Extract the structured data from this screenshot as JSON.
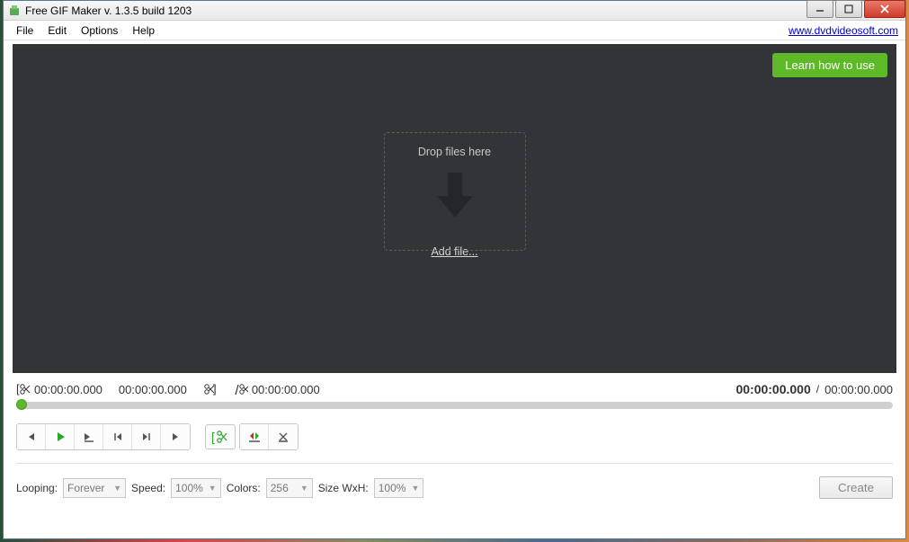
{
  "window": {
    "title": "Free GIF Maker v. 1.3.5 build 1203"
  },
  "menu": {
    "file": "File",
    "edit": "Edit",
    "options": "Options",
    "help": "Help",
    "website": "www.dvdvideosoft.com"
  },
  "preview": {
    "learn_label": "Learn how to use",
    "drop_label": "Drop files here",
    "add_file_label": "Add file..."
  },
  "timeline": {
    "trim_start": "00:00:00.000",
    "trim_duration": "00:00:00.000",
    "trim_end": "00:00:00.000",
    "current": "00:00:00.000",
    "total": "00:00:00.000",
    "slash": "/"
  },
  "settings": {
    "looping_label": "Looping:",
    "looping_value": "Forever",
    "speed_label": "Speed:",
    "speed_value": "100%",
    "colors_label": "Colors:",
    "colors_value": "256",
    "size_label": "Size WxH:",
    "size_value": "100%",
    "create_label": "Create"
  }
}
